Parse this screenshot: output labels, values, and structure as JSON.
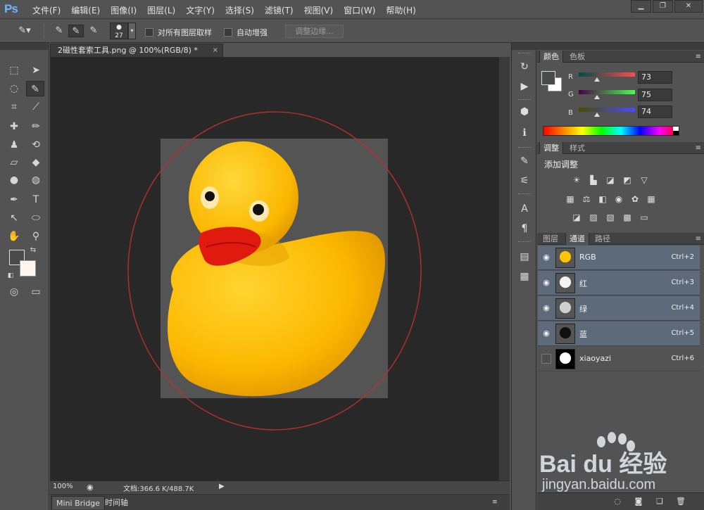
{
  "app": {
    "logo": "Ps"
  },
  "menu": [
    "文件(F)",
    "编辑(E)",
    "图像(I)",
    "图层(L)",
    "文字(Y)",
    "选择(S)",
    "滤镜(T)",
    "视图(V)",
    "窗口(W)",
    "帮助(H)"
  ],
  "window_controls": {
    "minimize": "▁",
    "restore": "❐",
    "close": "✕"
  },
  "options": {
    "brush_size": "27",
    "sample_all_layers": "对所有图层取样",
    "auto_enhance": "自动增强",
    "refine_edge": "调整边缘..."
  },
  "document": {
    "tab_title": "2磁性套索工具.png @ 100%(RGB/8) *",
    "close_glyph": "×",
    "zoom": "100%",
    "doc_size": "文档:366.6 K/488.7K"
  },
  "bottom_tabs": [
    "Mini Bridge",
    "时间轴"
  ],
  "color_panel": {
    "tabs": [
      "颜色",
      "色板"
    ],
    "r_label": "R",
    "g_label": "G",
    "b_label": "B",
    "r": "73",
    "g": "75",
    "b": "74",
    "foreground": "#494b4a",
    "background": "#ffffff"
  },
  "adjust_panel": {
    "tabs": [
      "调整",
      "样式"
    ],
    "title": "添加调整"
  },
  "layers_panel": {
    "tabs": [
      "图层",
      "通道",
      "路径"
    ],
    "channels": [
      {
        "name": "RGB",
        "shortcut": "Ctrl+2",
        "visible": true
      },
      {
        "name": "红",
        "shortcut": "Ctrl+3",
        "visible": true
      },
      {
        "name": "绿",
        "shortcut": "Ctrl+4",
        "visible": true
      },
      {
        "name": "蓝",
        "shortcut": "Ctrl+5",
        "visible": true
      },
      {
        "name": "xiaoyazi",
        "shortcut": "Ctrl+6",
        "visible": false
      }
    ]
  },
  "watermark": {
    "logo": "Bai du 经验",
    "url": "jingyan.baidu.com"
  },
  "colors": {
    "accent_selection": "#5c6a7a",
    "duck_yellow": "#ffc400",
    "beak_red": "#e11a10",
    "ellipse_red": "#c0302a"
  }
}
